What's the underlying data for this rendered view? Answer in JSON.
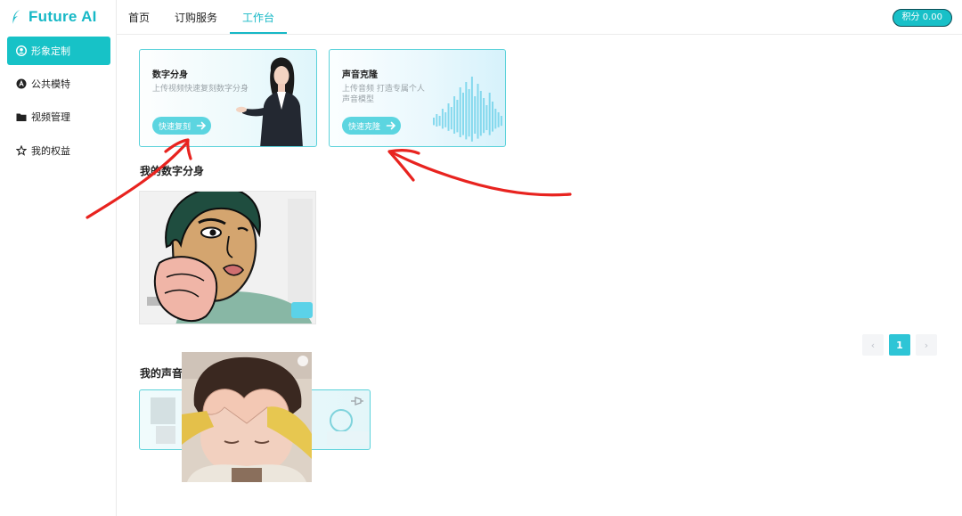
{
  "brand": {
    "name": "Future AI",
    "accent": "#16b8c6"
  },
  "topnav": [
    {
      "label": "首页",
      "active": false
    },
    {
      "label": "订购服务",
      "active": false
    },
    {
      "label": "工作台",
      "active": true
    }
  ],
  "points_label": "积分 0.00",
  "sidebar": [
    {
      "label": "形象定制",
      "icon": "user-circle-icon",
      "active": true
    },
    {
      "label": "公共模特",
      "icon": "model-icon",
      "active": false
    },
    {
      "label": "视频管理",
      "icon": "folder-icon",
      "active": false
    },
    {
      "label": "我的权益",
      "icon": "benefit-icon",
      "active": false
    }
  ],
  "cards": {
    "digital": {
      "title": "数字分身",
      "desc": "上传视频快速复刻数字分身",
      "button": "快速复刻"
    },
    "voice": {
      "title": "声音克隆",
      "desc": "上传音频 打造专属个人声音模型",
      "button": "快速克隆"
    }
  },
  "sections": {
    "my_avatar": "我的数字分身",
    "my_voice": "我的声音"
  },
  "pagination": {
    "current": "1",
    "prev": "‹",
    "next": "›"
  },
  "annotation_color": "#e8231f"
}
